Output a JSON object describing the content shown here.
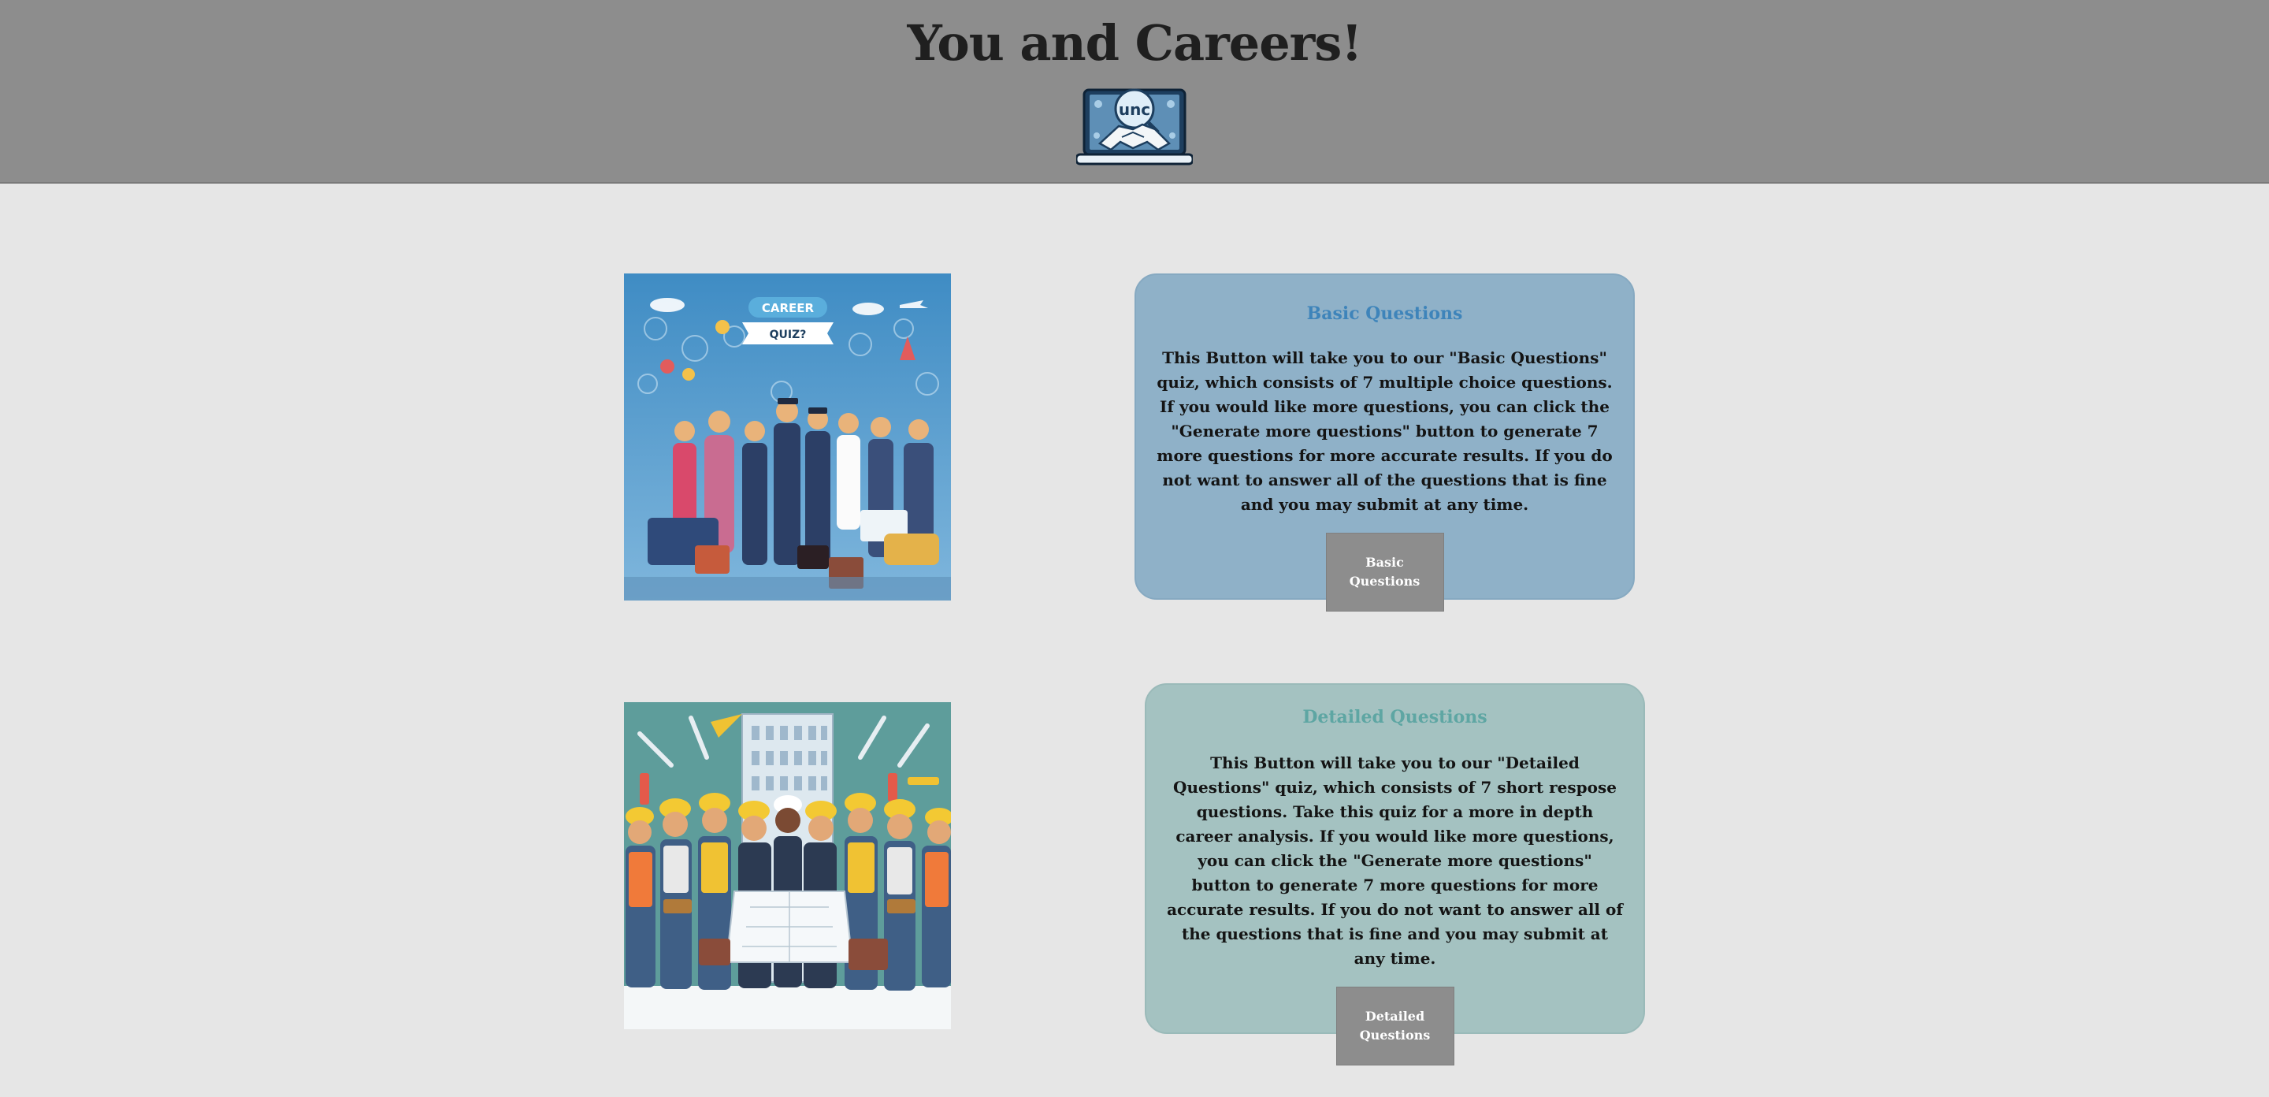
{
  "header": {
    "title": "You and Careers!",
    "logo_text": "unc"
  },
  "basic": {
    "image_label_top": "CAREER",
    "image_label_bottom": "QUIZ?",
    "title": "Basic Questions",
    "description": "This Button will take you to our \"Basic Questions\" quiz, which consists of 7 multiple choice questions. If you would like more questions, you can click the \"Generate more questions\" button to generate 7 more questions for more accurate results. If you do not want to answer all of the questions that is fine and you may submit at any time.",
    "button_label": "Basic Questions"
  },
  "detailed": {
    "title": "Detailed Questions",
    "description": "This Button will take you to our \"Detailed Questions\" quiz, which consists of 7 short respose questions. Take this quiz for a more in depth career analysis. If you would like more questions, you can click the \"Generate more questions\" button to generate 7 more questions for more accurate results. If you do not want to answer all of the questions that is fine and you may submit at any time.",
    "button_label": "Detailed Questions"
  },
  "colors": {
    "header_bg": "#8d8d8d",
    "page_bg": "#e6e6e6",
    "basic_card_bg": "#8fb1c8",
    "basic_title": "#3e84ba",
    "detailed_card_bg": "#a4c2c1",
    "detailed_title": "#5ea6a3",
    "button_bg": "#8d8d8d"
  }
}
